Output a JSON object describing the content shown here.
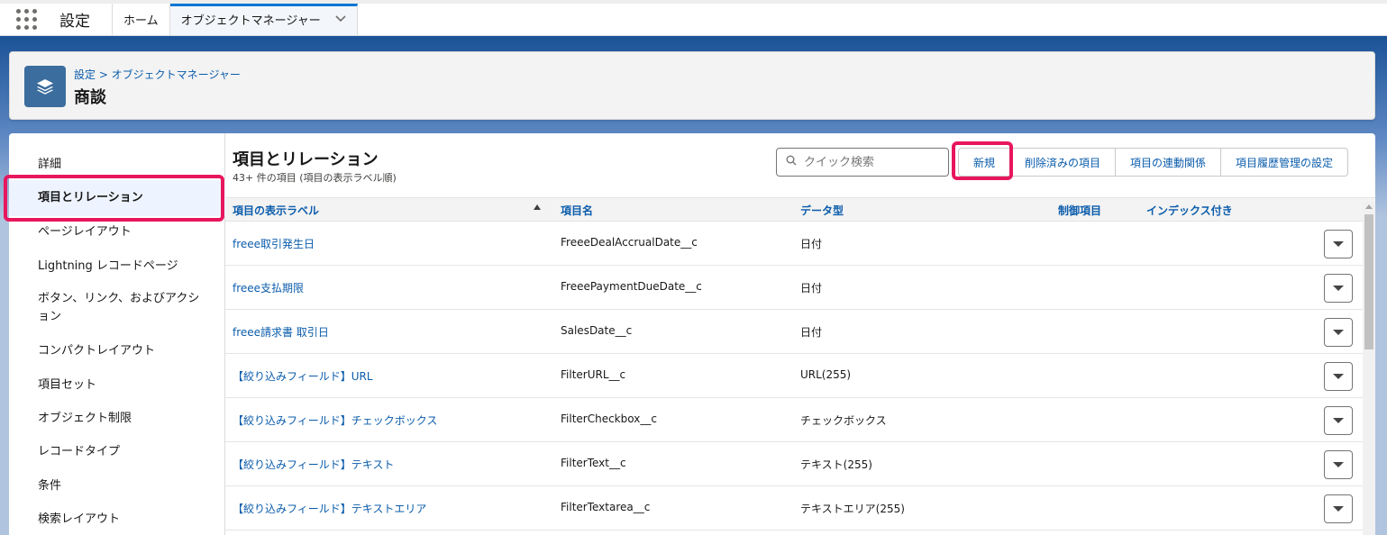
{
  "topbar": {
    "app_name": "設定",
    "tabs": [
      {
        "label": "ホーム"
      },
      {
        "label": "オブジェクトマネージャー"
      }
    ]
  },
  "header": {
    "breadcrumb": "設定 > オブジェクトマネージャー",
    "title": "商談",
    "icon": "layers-icon"
  },
  "sidebar": {
    "items": [
      {
        "label": "詳細"
      },
      {
        "label": "項目とリレーション"
      },
      {
        "label": "ページレイアウト"
      },
      {
        "label": "Lightning レコードページ"
      },
      {
        "label": "ボタン、リンク、およびアクション"
      },
      {
        "label": "コンパクトレイアウト"
      },
      {
        "label": "項目セット"
      },
      {
        "label": "オブジェクト制限"
      },
      {
        "label": "レコードタイプ"
      },
      {
        "label": "条件"
      },
      {
        "label": "検索レイアウト"
      }
    ],
    "selected_index": 1
  },
  "section": {
    "title": "項目とリレーション",
    "subtitle": "43+ 件の項目 (項目の表示ラベル順)"
  },
  "search": {
    "placeholder": "クイック検索"
  },
  "buttons": {
    "new": "新規",
    "deleted": "削除済みの項目",
    "dependencies": "項目の連動関係",
    "history": "項目履歴管理の設定"
  },
  "table": {
    "columns": [
      "項目の表示ラベル",
      "項目名",
      "データ型",
      "制御項目",
      "インデックス付き"
    ],
    "rows": [
      {
        "label": "freee取引発生日",
        "api": "FreeeDealAccrualDate__c",
        "type": "日付"
      },
      {
        "label": "freee支払期限",
        "api": "FreeePaymentDueDate__c",
        "type": "日付"
      },
      {
        "label": "freee請求書 取引日",
        "api": "SalesDate__c",
        "type": "日付"
      },
      {
        "label": "【絞り込みフィールド】URL",
        "api": "FilterURL__c",
        "type": "URL(255)"
      },
      {
        "label": "【絞り込みフィールド】チェックボックス",
        "api": "FilterCheckbox__c",
        "type": "チェックボックス"
      },
      {
        "label": "【絞り込みフィールド】テキスト",
        "api": "FilterText__c",
        "type": "テキスト(255)"
      },
      {
        "label": "【絞り込みフィールド】テキストエリア",
        "api": "FilterTextarea__c",
        "type": "テキストエリア(255)"
      }
    ]
  },
  "colors": {
    "highlight": "#e8175d",
    "link": "#0b5cab",
    "brand_blue": "#1b5297"
  }
}
